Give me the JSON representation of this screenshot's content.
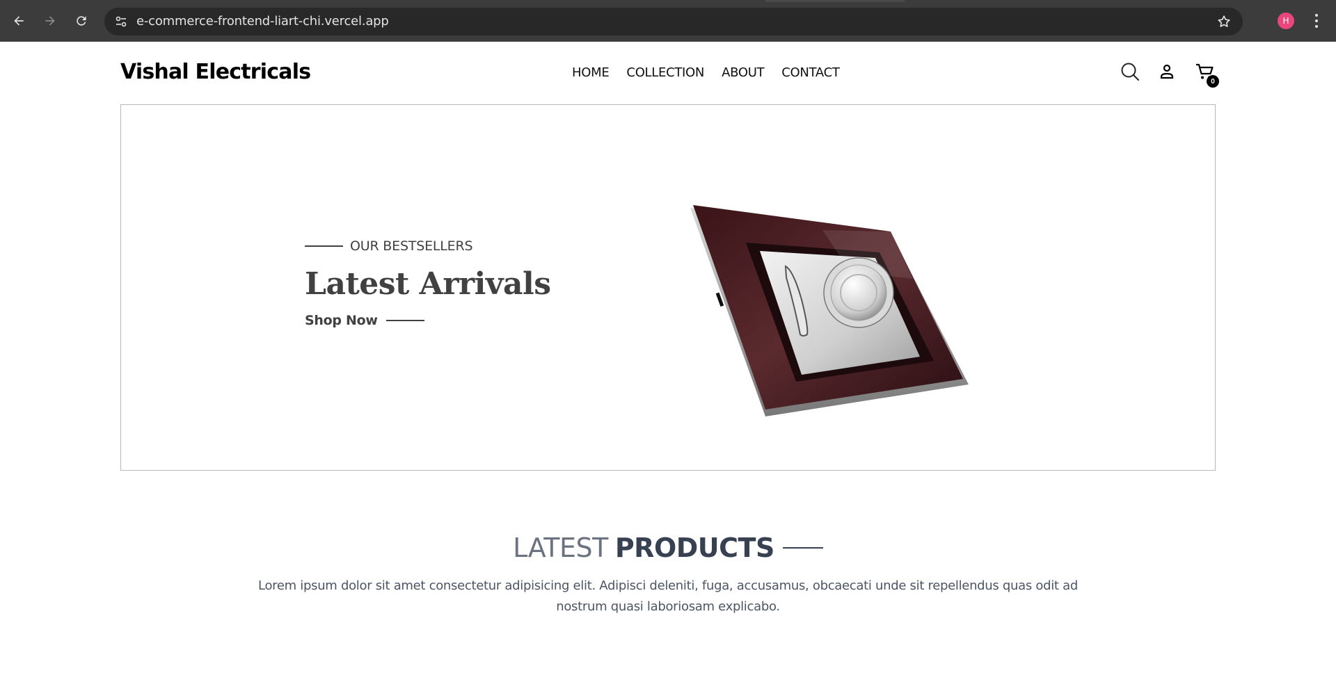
{
  "browser": {
    "url": "e-commerce-frontend-liart-chi.vercel.app",
    "profile_initial": "H",
    "profile_color": "#e8467c"
  },
  "header": {
    "logo": "Vishal Electricals",
    "nav": [
      "HOME",
      "COLLECTION",
      "ABOUT",
      "CONTACT"
    ],
    "cart_count": "0",
    "icons": [
      "search-icon",
      "profile-icon",
      "cart-icon"
    ]
  },
  "hero": {
    "eyebrow": "OUR BESTSELLERS",
    "title": "Latest Arrivals",
    "cta": "Shop Now",
    "image": "smart-switch-panel"
  },
  "latest_products": {
    "title_part1": "LATEST",
    "title_part2": "PRODUCTS",
    "description": "Lorem ipsum dolor sit amet consectetur adipisicing elit. Adipisci deleniti, fuga, accusamus, obcaecati unde sit repellendus quas odit ad nostrum quasi laboriosam explicabo."
  },
  "colors": {
    "chrome_bg": "#3c3c3c",
    "omnibox_bg": "#282828",
    "text_dark": "#414141",
    "title_gray": "#6b7280"
  }
}
